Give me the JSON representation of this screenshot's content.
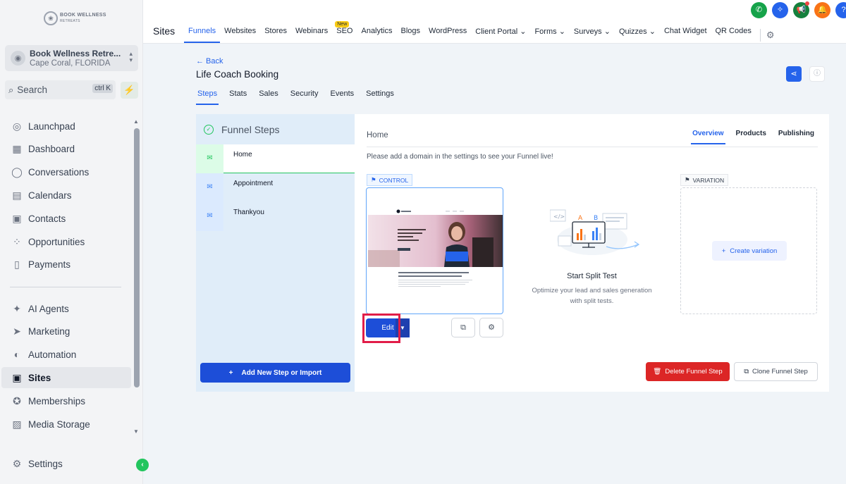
{
  "brand": {
    "logo_text_1": "BOOK WELLNESS",
    "logo_text_2": "RETREATS"
  },
  "account": {
    "name": "Book Wellness Retre...",
    "location": "Cape Coral, FLORIDA"
  },
  "search": {
    "label": "Search",
    "shortcut": "ctrl K"
  },
  "sidebar": {
    "items": [
      {
        "label": "Launchpad",
        "icon": "rocket-icon"
      },
      {
        "label": "Dashboard",
        "icon": "grid-icon"
      },
      {
        "label": "Conversations",
        "icon": "chat-icon"
      },
      {
        "label": "Calendars",
        "icon": "calendar-icon"
      },
      {
        "label": "Contacts",
        "icon": "contacts-icon"
      },
      {
        "label": "Opportunities",
        "icon": "opportunities-icon"
      },
      {
        "label": "Payments",
        "icon": "payments-icon"
      }
    ],
    "items2": [
      {
        "label": "AI Agents",
        "icon": "sparkle-icon"
      },
      {
        "label": "Marketing",
        "icon": "send-icon"
      },
      {
        "label": "Automation",
        "icon": "automation-icon"
      },
      {
        "label": "Sites",
        "icon": "sites-icon"
      },
      {
        "label": "Memberships",
        "icon": "badge-icon"
      },
      {
        "label": "Media Storage",
        "icon": "image-icon"
      }
    ],
    "settings": "Settings"
  },
  "topbar": {
    "section": "Sites",
    "tabs": [
      "Funnels",
      "Websites",
      "Stores",
      "Webinars",
      "SEO",
      "Analytics",
      "Blogs",
      "WordPress",
      "Client Portal",
      "Forms",
      "Surveys",
      "Quizzes",
      "Chat Widget",
      "QR Codes"
    ],
    "new_badge": "New",
    "icon_colors": [
      "#16a34a",
      "#2563eb",
      "#15803d",
      "#f97316",
      "#2563eb"
    ]
  },
  "page": {
    "back": "← Back",
    "title": "Life Coach Booking",
    "tabs": [
      "Steps",
      "Stats",
      "Sales",
      "Security",
      "Events",
      "Settings"
    ]
  },
  "steps": {
    "heading": "Funnel Steps",
    "items": [
      "Home",
      "Appointment",
      "Thankyou"
    ],
    "add_button": "Add New Step or Import"
  },
  "detail": {
    "title": "Home",
    "tabs": [
      "Overview",
      "Products",
      "Publishing"
    ],
    "notice": "Please add a domain in the settings to see your Funnel live!",
    "control_tag": "CONTROL",
    "variation_tag": "VARIATION",
    "edit_label": "Edit",
    "split_title": "Start Split Test",
    "split_desc": "Optimize your lead and sales generation with split tests.",
    "create_variation": "Create variation",
    "delete_label": "Delete Funnel Step",
    "clone_label": "Clone Funnel Step"
  }
}
